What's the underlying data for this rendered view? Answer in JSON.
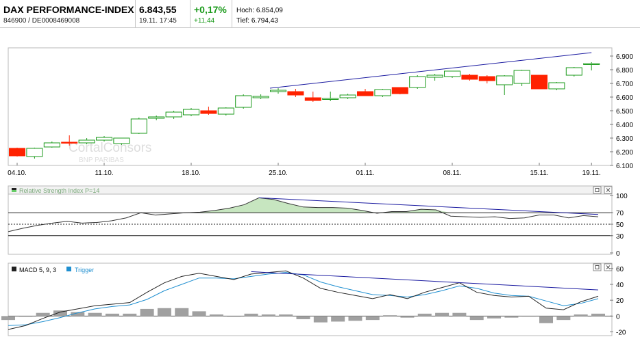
{
  "header": {
    "name": "DAX PERFORMANCE-INDEX",
    "id": "846900 / DE0008469008",
    "price": "6.843,55",
    "datetime": "19.11. 17:45",
    "change_pct": "+0,17%",
    "change_abs": "+11,44",
    "high": "Hoch: 6.854,09",
    "low": "Tief: 6.794,43"
  },
  "colors": {
    "up": "#1a9a1a",
    "down": "#ff2200",
    "trend": "#1a1aa0",
    "rsi_fill": "#c7e6c0",
    "macd": "#222222",
    "trigger": "#1f8fd0",
    "hist": "#a0a0a0"
  },
  "watermark": {
    "line1": "CortalConsors",
    "line2": "BNP PARIBAS"
  },
  "chart_data": [
    {
      "type": "candlestick",
      "ylim": [
        6100,
        6950
      ],
      "yticks": [
        "6.900",
        "6.800",
        "6.700",
        "6.600",
        "6.500",
        "6.400",
        "6.300",
        "6.200",
        "6.100"
      ],
      "ytick_values": [
        6900,
        6800,
        6700,
        6600,
        6500,
        6400,
        6300,
        6200,
        6100
      ],
      "xtick_labels": [
        "04.10.",
        "11.10.",
        "18.10.",
        "25.10.",
        "01.11.",
        "08.11.",
        "15.11.",
        "19.11."
      ],
      "xtick_index": [
        0,
        5,
        10,
        15,
        20,
        25,
        30,
        33
      ],
      "candles": [
        {
          "o": 6225,
          "h": 6230,
          "l": 6165,
          "c": 6170
        },
        {
          "o": 6165,
          "h": 6230,
          "l": 6150,
          "c": 6225
        },
        {
          "o": 6235,
          "h": 6275,
          "l": 6230,
          "c": 6265
        },
        {
          "o": 6270,
          "h": 6320,
          "l": 6245,
          "c": 6265
        },
        {
          "o": 6265,
          "h": 6300,
          "l": 6255,
          "c": 6285
        },
        {
          "o": 6285,
          "h": 6315,
          "l": 6275,
          "c": 6305
        },
        {
          "o": 6260,
          "h": 6300,
          "l": 6250,
          "c": 6300
        },
        {
          "o": 6335,
          "h": 6450,
          "l": 6330,
          "c": 6440
        },
        {
          "o": 6445,
          "h": 6465,
          "l": 6430,
          "c": 6455
        },
        {
          "o": 6455,
          "h": 6500,
          "l": 6440,
          "c": 6490
        },
        {
          "o": 6470,
          "h": 6520,
          "l": 6460,
          "c": 6510
        },
        {
          "o": 6500,
          "h": 6530,
          "l": 6470,
          "c": 6480
        },
        {
          "o": 6475,
          "h": 6525,
          "l": 6465,
          "c": 6520
        },
        {
          "o": 6525,
          "h": 6620,
          "l": 6515,
          "c": 6610
        },
        {
          "o": 6595,
          "h": 6620,
          "l": 6585,
          "c": 6605
        },
        {
          "o": 6640,
          "h": 6665,
          "l": 6625,
          "c": 6650
        },
        {
          "o": 6640,
          "h": 6660,
          "l": 6600,
          "c": 6615
        },
        {
          "o": 6595,
          "h": 6640,
          "l": 6565,
          "c": 6575
        },
        {
          "o": 6590,
          "h": 6640,
          "l": 6570,
          "c": 6590
        },
        {
          "o": 6595,
          "h": 6625,
          "l": 6585,
          "c": 6615
        },
        {
          "o": 6640,
          "h": 6660,
          "l": 6610,
          "c": 6610
        },
        {
          "o": 6610,
          "h": 6660,
          "l": 6600,
          "c": 6655
        },
        {
          "o": 6670,
          "h": 6670,
          "l": 6620,
          "c": 6625
        },
        {
          "o": 6670,
          "h": 6760,
          "l": 6660,
          "c": 6750
        },
        {
          "o": 6745,
          "h": 6770,
          "l": 6720,
          "c": 6760
        },
        {
          "o": 6750,
          "h": 6790,
          "l": 6740,
          "c": 6790
        },
        {
          "o": 6760,
          "h": 6770,
          "l": 6720,
          "c": 6730
        },
        {
          "o": 6750,
          "h": 6760,
          "l": 6700,
          "c": 6720
        },
        {
          "o": 6690,
          "h": 6760,
          "l": 6615,
          "c": 6755
        },
        {
          "o": 6700,
          "h": 6800,
          "l": 6680,
          "c": 6795
        },
        {
          "o": 6760,
          "h": 6760,
          "l": 6660,
          "c": 6660
        },
        {
          "o": 6660,
          "h": 6710,
          "l": 6650,
          "c": 6705
        },
        {
          "o": 6760,
          "h": 6820,
          "l": 6750,
          "c": 6815
        },
        {
          "o": 6840,
          "h": 6855,
          "l": 6795,
          "c": 6845
        }
      ],
      "trendline": {
        "from": [
          15,
          6665
        ],
        "to": [
          33,
          6925
        ]
      }
    },
    {
      "type": "line",
      "title": "Relative Strength Index P=14",
      "ylim": [
        0,
        100
      ],
      "yticks": [
        100,
        70,
        50,
        30,
        0
      ],
      "levels": [
        70,
        50,
        30
      ],
      "values": [
        37,
        43,
        48,
        52,
        55,
        52,
        53,
        56,
        61,
        70,
        66,
        68,
        70,
        71,
        74,
        78,
        84,
        96,
        93,
        86,
        80,
        79,
        79,
        78,
        74,
        69,
        72,
        72,
        76,
        75,
        64,
        63,
        62,
        63,
        60,
        61,
        66,
        66,
        61,
        65,
        63
      ],
      "trendline": {
        "from": [
          17,
          96
        ],
        "to": [
          40,
          67
        ]
      }
    },
    {
      "type": "line",
      "title": "MACD 5, 9, 3",
      "series_names": [
        "MACD 5, 9, 3",
        "Trigger"
      ],
      "ylim": [
        -23,
        65
      ],
      "yticks": [
        60,
        40,
        20,
        0,
        -20
      ],
      "macd": [
        -17,
        -12,
        -3,
        5,
        9,
        13,
        15,
        17,
        30,
        42,
        50,
        54,
        50,
        46,
        53,
        55,
        57,
        48,
        35,
        30,
        26,
        22,
        27,
        22,
        30,
        36,
        42,
        30,
        26,
        24,
        25,
        10,
        8,
        18,
        25
      ],
      "trigger": [
        -12,
        -11,
        -7,
        -2,
        4,
        9,
        12,
        14,
        21,
        32,
        40,
        48,
        48,
        47,
        50,
        53,
        55,
        52,
        43,
        37,
        32,
        27,
        26,
        24,
        27,
        32,
        38,
        35,
        29,
        26,
        25,
        19,
        13,
        16,
        22
      ],
      "hist": [
        -5,
        -1,
        4,
        7,
        5,
        4,
        3,
        3,
        9,
        10,
        10,
        6,
        2,
        -1,
        3,
        2,
        2,
        -4,
        -8,
        -7,
        -6,
        -5,
        1,
        -2,
        3,
        4,
        4,
        -5,
        -3,
        -2,
        0,
        -9,
        -5,
        2,
        3
      ],
      "trendline": {
        "from": [
          14,
          56
        ],
        "to": [
          34,
          33
        ]
      }
    }
  ]
}
